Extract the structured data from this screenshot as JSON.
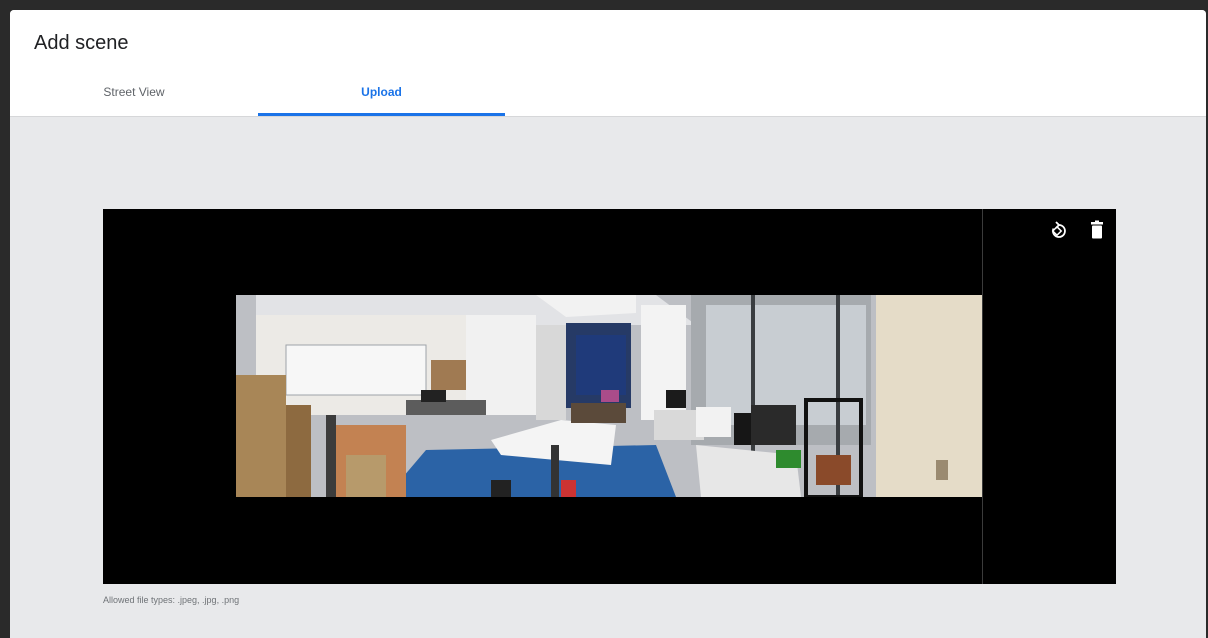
{
  "dialog": {
    "title": "Add scene",
    "tabs": [
      {
        "label": "Street View",
        "active": false
      },
      {
        "label": "Upload",
        "active": true
      }
    ]
  },
  "preview": {
    "actions": [
      {
        "name": "rotate",
        "icon": "rotate-icon"
      },
      {
        "name": "delete",
        "icon": "trash-icon"
      }
    ],
    "image": "panoramic office photo"
  },
  "hint": "Allowed file types: .jpeg, .jpg, .png",
  "colors": {
    "accent": "#1a73e8",
    "background": "#e8e9eb"
  }
}
